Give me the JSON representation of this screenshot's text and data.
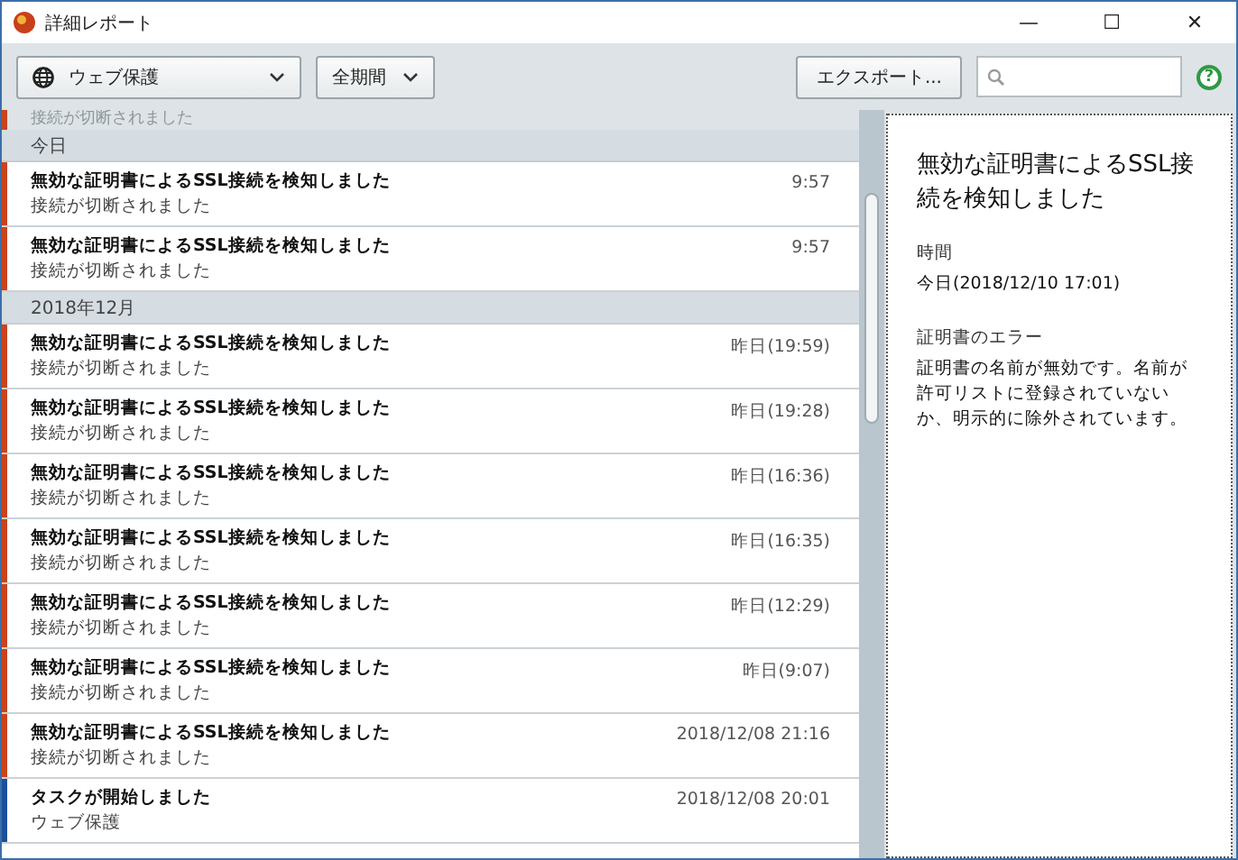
{
  "window": {
    "title": "詳細レポート",
    "controls": [
      "—",
      "☐",
      "✕"
    ]
  },
  "toolbar": {
    "component_dropdown": {
      "value": "ウェブ保護"
    },
    "period_dropdown": {
      "value": "全期間"
    },
    "export_button": "エクスポート...",
    "help": "?"
  },
  "list": [
    {
      "kind": "partial",
      "subtitle": "接続が切断されました"
    },
    {
      "kind": "header",
      "label": "今日"
    },
    {
      "kind": "event",
      "title": "無効な証明書によるSSL接続を検知しました",
      "subtitle": "接続が切断されました",
      "time": "9:57",
      "color": "#c9441c"
    },
    {
      "kind": "event",
      "title": "無効な証明書によるSSL接続を検知しました",
      "subtitle": "接続が切断されました",
      "time": "9:57",
      "color": "#c9441c"
    },
    {
      "kind": "header",
      "label": "2018年12月"
    },
    {
      "kind": "event",
      "title": "無効な証明書によるSSL接続を検知しました",
      "subtitle": "接続が切断されました",
      "time": "昨日(19:59)",
      "color": "#c9441c"
    },
    {
      "kind": "event",
      "title": "無効な証明書によるSSL接続を検知しました",
      "subtitle": "接続が切断されました",
      "time": "昨日(19:28)",
      "color": "#c9441c"
    },
    {
      "kind": "event",
      "title": "無効な証明書によるSSL接続を検知しました",
      "subtitle": "接続が切断されました",
      "time": "昨日(16:36)",
      "color": "#c9441c"
    },
    {
      "kind": "event",
      "title": "無効な証明書によるSSL接続を検知しました",
      "subtitle": "接続が切断されました",
      "time": "昨日(16:35)",
      "color": "#c9441c"
    },
    {
      "kind": "event",
      "title": "無効な証明書によるSSL接続を検知しました",
      "subtitle": "接続が切断されました",
      "time": "昨日(12:29)",
      "color": "#c9441c"
    },
    {
      "kind": "event",
      "title": "無効な証明書によるSSL接続を検知しました",
      "subtitle": "接続が切断されました",
      "time": "昨日(9:07)",
      "color": "#c9441c"
    },
    {
      "kind": "event",
      "title": "無効な証明書によるSSL接続を検知しました",
      "subtitle": "接続が切断されました",
      "time": "2018/12/08 21:16",
      "color": "#c9441c"
    },
    {
      "kind": "event",
      "title": "タスクが開始しました",
      "subtitle": "ウェブ保護",
      "time": "2018/12/08 20:01",
      "color": "#1d4f9c"
    }
  ],
  "details": {
    "title": "無効な証明書によるSSL接続を検知しました",
    "fields": [
      {
        "label": "時間",
        "value": "今日(2018/12/10 17:01)"
      },
      {
        "label": "証明書のエラー",
        "value": "証明書の名前が無効です。名前が許可リストに登録されていないか、明示的に除外されています。"
      }
    ]
  }
}
